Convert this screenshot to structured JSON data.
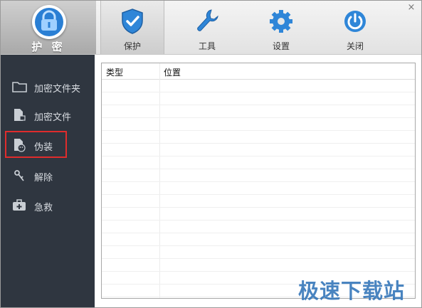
{
  "window": {
    "close_glyph": "×"
  },
  "logo": {
    "text": "护 密",
    "icon": "lock-shield-icon"
  },
  "tabs": [
    {
      "label": "保护",
      "icon": "shield-check-icon",
      "active": true
    },
    {
      "label": "工具",
      "icon": "wrench-icon",
      "active": false
    },
    {
      "label": "设置",
      "icon": "gear-icon",
      "active": false
    },
    {
      "label": "关闭",
      "icon": "power-icon",
      "active": false
    }
  ],
  "sidebar": {
    "items": [
      {
        "label": "加密文件夹",
        "icon": "folder-icon"
      },
      {
        "label": "加密文件",
        "icon": "file-lock-icon"
      },
      {
        "label": "伪装",
        "icon": "mask-icon",
        "selected": true
      },
      {
        "label": "解除",
        "icon": "unlock-key-icon"
      },
      {
        "label": "急救",
        "icon": "first-aid-kit-icon"
      }
    ]
  },
  "table": {
    "columns": [
      "类型",
      "位置"
    ],
    "rows": []
  },
  "watermark": {
    "text": "极速下载站"
  },
  "colors": {
    "sidebar_bg": "#2f3640",
    "selection_outline": "#e02c2c",
    "accent_blue": "#2a7fd4"
  }
}
